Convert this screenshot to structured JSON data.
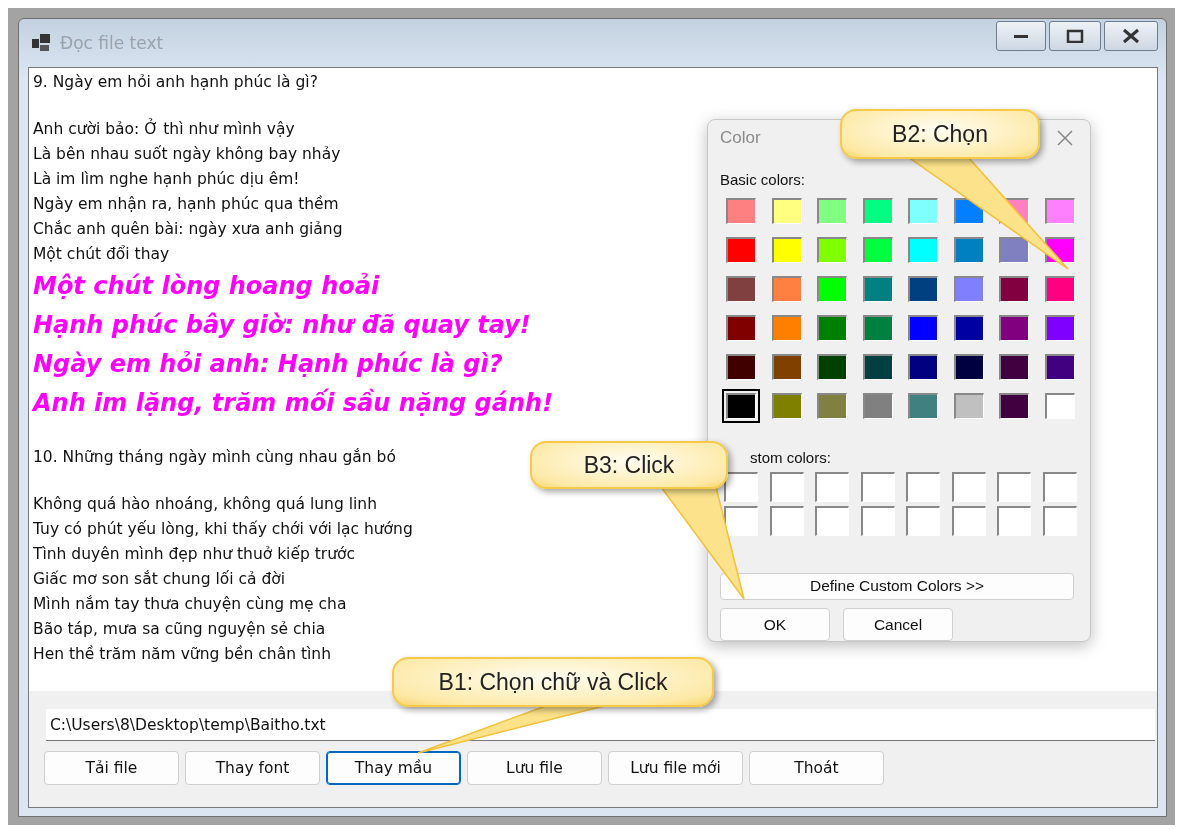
{
  "window": {
    "title": "Đọc file text"
  },
  "stanzas": [
    {
      "lines": [
        {
          "text": "9. Ngày em hỏi anh hạnh phúc là gì?",
          "kind": "plain"
        }
      ]
    },
    {
      "lines": [
        {
          "text": "Anh cười bảo: Ở thì như mình vậy",
          "kind": "plain"
        },
        {
          "text": "Là bên nhau suốt ngày không bay nhảy",
          "kind": "plain"
        },
        {
          "text": "Là im lìm nghe hạnh phúc dịu êm!",
          "kind": "plain"
        },
        {
          "text": "Ngày em nhận ra, hạnh phúc qua thềm",
          "kind": "plain"
        },
        {
          "text": "Chắc anh quên bài: ngày xưa anh giảng",
          "kind": "plain"
        },
        {
          "text": "Một chút đổi thay",
          "kind": "plain"
        },
        {
          "text": "Một chút lòng hoang hoải",
          "kind": "highlight"
        },
        {
          "text": "Hạnh phúc bây giờ: như đã quay tay!",
          "kind": "highlight"
        },
        {
          "text": "Ngày em hỏi anh: Hạnh phúc là gì?",
          "kind": "highlight"
        },
        {
          "text": "Anh im lặng, trăm mối sầu nặng gánh!",
          "kind": "highlight"
        }
      ]
    },
    {
      "lines": [
        {
          "text": "10. Những tháng ngày mình cùng nhau gắn bó",
          "kind": "plain"
        }
      ]
    },
    {
      "lines": [
        {
          "text": "Không quá hào nhoáng, không quá lung linh",
          "kind": "plain"
        },
        {
          "text": "Tuy có phút yếu lòng, khi thấy chới với lạc hướng",
          "kind": "plain"
        },
        {
          "text": "Tình duyên mình đẹp như thuở kiếp trước",
          "kind": "plain"
        },
        {
          "text": "Giấc mơ son sắt chung lối cả đời",
          "kind": "plain"
        },
        {
          "text": "Mình nắm tay thưa chuyện cùng mẹ cha",
          "kind": "plain"
        },
        {
          "text": "Bão táp, mưa sa cũng nguyện sẻ chia",
          "kind": "plain"
        },
        {
          "text": "Hen thề trăm năm vững bền chân tình",
          "kind": "plain"
        }
      ]
    }
  ],
  "path_field": {
    "value": "C:\\Users\\8\\Desktop\\temp\\Baitho.txt"
  },
  "buttons": [
    {
      "label": "Tải file",
      "focused": false
    },
    {
      "label": "Thay font",
      "focused": false
    },
    {
      "label": "Thay mầu",
      "focused": true
    },
    {
      "label": "Lưu file",
      "focused": false
    },
    {
      "label": "Lưu file mới",
      "focused": false
    },
    {
      "label": "Thoát",
      "focused": false
    }
  ],
  "color_dialog": {
    "title": "Color",
    "basic_label": "Basic colors:",
    "basic_colors": [
      {
        "color": "#ff8080",
        "selected": false
      },
      {
        "color": "#ffff80",
        "selected": false
      },
      {
        "color": "#80ff80",
        "selected": false
      },
      {
        "color": "#00ff80",
        "selected": false
      },
      {
        "color": "#80ffff",
        "selected": false
      },
      {
        "color": "#0080ff",
        "selected": false
      },
      {
        "color": "#ff80c0",
        "selected": false
      },
      {
        "color": "#ff80ff",
        "selected": false
      },
      {
        "color": "#ff0000",
        "selected": false
      },
      {
        "color": "#ffff00",
        "selected": false
      },
      {
        "color": "#80ff00",
        "selected": false
      },
      {
        "color": "#00ff40",
        "selected": false
      },
      {
        "color": "#00ffff",
        "selected": false
      },
      {
        "color": "#0080c0",
        "selected": false
      },
      {
        "color": "#8080c0",
        "selected": false
      },
      {
        "color": "#ff00ff",
        "selected": false
      },
      {
        "color": "#804040",
        "selected": false
      },
      {
        "color": "#ff8040",
        "selected": false
      },
      {
        "color": "#00ff00",
        "selected": false
      },
      {
        "color": "#008080",
        "selected": false
      },
      {
        "color": "#004080",
        "selected": false
      },
      {
        "color": "#8080ff",
        "selected": false
      },
      {
        "color": "#800040",
        "selected": false
      },
      {
        "color": "#ff0080",
        "selected": false
      },
      {
        "color": "#800000",
        "selected": false
      },
      {
        "color": "#ff8000",
        "selected": false
      },
      {
        "color": "#008000",
        "selected": false
      },
      {
        "color": "#008040",
        "selected": false
      },
      {
        "color": "#0000ff",
        "selected": false
      },
      {
        "color": "#0000a0",
        "selected": false
      },
      {
        "color": "#800080",
        "selected": false
      },
      {
        "color": "#8000ff",
        "selected": false
      },
      {
        "color": "#400000",
        "selected": false
      },
      {
        "color": "#804000",
        "selected": false
      },
      {
        "color": "#004000",
        "selected": false
      },
      {
        "color": "#004040",
        "selected": false
      },
      {
        "color": "#000080",
        "selected": false
      },
      {
        "color": "#000040",
        "selected": false
      },
      {
        "color": "#400040",
        "selected": false
      },
      {
        "color": "#400080",
        "selected": false
      },
      {
        "color": "#000000",
        "selected": true
      },
      {
        "color": "#808000",
        "selected": false
      },
      {
        "color": "#808040",
        "selected": false
      },
      {
        "color": "#808080",
        "selected": false
      },
      {
        "color": "#408080",
        "selected": false
      },
      {
        "color": "#c0c0c0",
        "selected": false
      },
      {
        "color": "#400040",
        "selected": false
      },
      {
        "color": "#ffffff",
        "selected": false
      }
    ],
    "custom_label": "stom colors:",
    "custom_colors": [
      {
        "color": "#ffffff"
      },
      {
        "color": "#ffffff"
      },
      {
        "color": "#ffffff"
      },
      {
        "color": "#ffffff"
      },
      {
        "color": "#ffffff"
      },
      {
        "color": "#ffffff"
      },
      {
        "color": "#ffffff"
      },
      {
        "color": "#ffffff"
      },
      {
        "color": "#ffffff"
      },
      {
        "color": "#ffffff"
      },
      {
        "color": "#ffffff"
      },
      {
        "color": "#ffffff"
      },
      {
        "color": "#ffffff"
      },
      {
        "color": "#ffffff"
      },
      {
        "color": "#ffffff"
      },
      {
        "color": "#ffffff"
      }
    ],
    "define_button": "Define Custom Colors >>",
    "ok_button": "OK",
    "cancel_button": "Cancel"
  },
  "callouts": [
    {
      "text": "B2: Chọn"
    },
    {
      "text": "B3: Click"
    },
    {
      "text": "B1: Chọn chữ và Click"
    }
  ]
}
